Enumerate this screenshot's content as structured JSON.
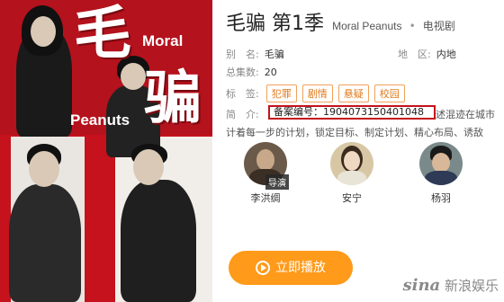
{
  "poster": {
    "title_cn_1": "毛",
    "title_cn_2": "骗",
    "title_en_1": "Moral",
    "title_en_2": "Peanuts"
  },
  "header": {
    "title": "毛骗 第1季",
    "title_en": "Moral Peanuts",
    "separator": "•",
    "type": "电视剧"
  },
  "fields": {
    "alias_label": "别　名:",
    "alias_value": "毛骗",
    "region_label": "地　区:",
    "region_value": "内地",
    "episodes_label": "总集数:",
    "episodes_value": "20",
    "tags_label": "标　签:",
    "tags": [
      "犯罪",
      "剧情",
      "悬疑",
      "校园"
    ],
    "intro_label": "简　介:"
  },
  "description": {
    "record_number": "备案编号：1904073150401048",
    "line1_tail": "述混迹在城市",
    "line2": "计着每一步的计划，锁定目标、制定计划、精心布局、诱敌"
  },
  "cast": [
    {
      "name": "李洪绸",
      "badge": "导演"
    },
    {
      "name": "安宁",
      "badge": ""
    },
    {
      "name": "杨羽",
      "badge": ""
    }
  ],
  "play_button": {
    "label": "立即播放"
  },
  "watermark": {
    "logo": "sina",
    "text": "新浪娱乐"
  },
  "colors": {
    "accent_orange": "#ff9a1a",
    "tag_border": "#f0a25a",
    "highlight_red": "#c4121b",
    "poster_red": "#b4121d"
  }
}
